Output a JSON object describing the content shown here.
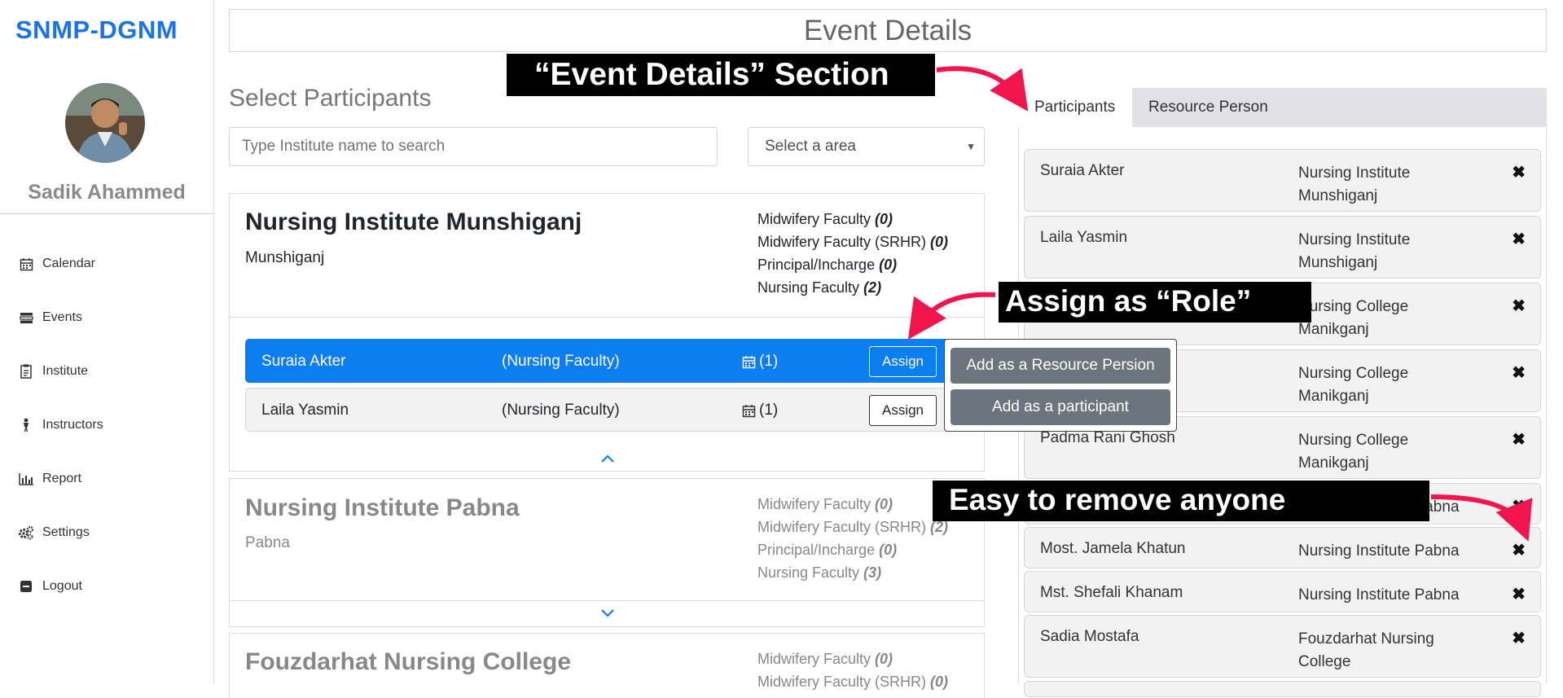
{
  "sidebar": {
    "brand": "SNMP-DGNM",
    "user_name": "Sadik Ahammed",
    "items": [
      {
        "label": "Calendar",
        "icon": "calendar-icon"
      },
      {
        "label": "Events",
        "icon": "events-icon"
      },
      {
        "label": "Institute",
        "icon": "institute-icon"
      },
      {
        "label": "Instructors",
        "icon": "instructor-icon"
      },
      {
        "label": "Report",
        "icon": "bar-chart-icon"
      },
      {
        "label": "Settings",
        "icon": "gears-icon"
      },
      {
        "label": "Logout",
        "icon": "logout-icon"
      }
    ]
  },
  "header": {
    "title": "Event Details"
  },
  "select_participants": {
    "title": "Select Participants",
    "search_placeholder": "Type Institute name to search",
    "area_select": "Select a area"
  },
  "institutes": [
    {
      "name": "Nursing Institute Munshiganj",
      "location": "Munshiganj",
      "faculty": [
        {
          "label": "Midwifery Faculty",
          "count": "(0)"
        },
        {
          "label": "Midwifery Faculty (SRHR)",
          "count": "(0)"
        },
        {
          "label": "Principal/Incharge",
          "count": "(0)"
        },
        {
          "label": "Nursing Faculty",
          "count": "(2)"
        }
      ],
      "participants": [
        {
          "name": "Suraia Akter",
          "role": "(Nursing Faculty)",
          "events": "(1)",
          "assign": "Assign"
        },
        {
          "name": "Laila Yasmin",
          "role": "(Nursing Faculty)",
          "events": "(1)",
          "assign": "Assign"
        }
      ]
    },
    {
      "name": "Nursing Institute Pabna",
      "location": "Pabna",
      "faculty": [
        {
          "label": "Midwifery Faculty",
          "count": "(0)"
        },
        {
          "label": "Midwifery Faculty (SRHR)",
          "count": "(2)"
        },
        {
          "label": "Principal/Incharge",
          "count": "(0)"
        },
        {
          "label": "Nursing Faculty",
          "count": "(3)"
        }
      ]
    },
    {
      "name": "Fouzdarhat Nursing College",
      "faculty": [
        {
          "label": "Midwifery Faculty",
          "count": "(0)"
        },
        {
          "label": "Midwifery Faculty (SRHR)",
          "count": "(0)"
        }
      ]
    }
  ],
  "assign_popup": {
    "resource_label": "Add as a Resource Persion",
    "participant_label": "Add as a participant"
  },
  "right_panel": {
    "tabs": [
      "Participants",
      "Resource Person"
    ],
    "selected": [
      {
        "name": "Suraia Akter",
        "institute": "Nursing Institute Munshiganj"
      },
      {
        "name": "Laila Yasmin",
        "institute": "Nursing Institute Munshiganj"
      },
      {
        "name": "",
        "institute": "Nursing College Manikganj"
      },
      {
        "name": "",
        "institute": "Nursing College Manikganj"
      },
      {
        "name": "Padma Rani Ghosh",
        "institute": "Nursing College Manikganj"
      },
      {
        "name": "",
        "institute": "Nursing Institute Pabna"
      },
      {
        "name": "Most. Jamela Khatun",
        "institute": "Nursing Institute Pabna"
      },
      {
        "name": "Mst. Shefali Khanam",
        "institute": "Nursing Institute Pabna"
      },
      {
        "name": "Sadia Mostafa",
        "institute": "Fouzdarhat Nursing College"
      }
    ],
    "remove_symbol": "✖"
  },
  "annotations": {
    "event_details": "“Event Details” Section",
    "assign_role": "Assign as “Role”",
    "easy_remove": "Easy to remove anyone"
  }
}
